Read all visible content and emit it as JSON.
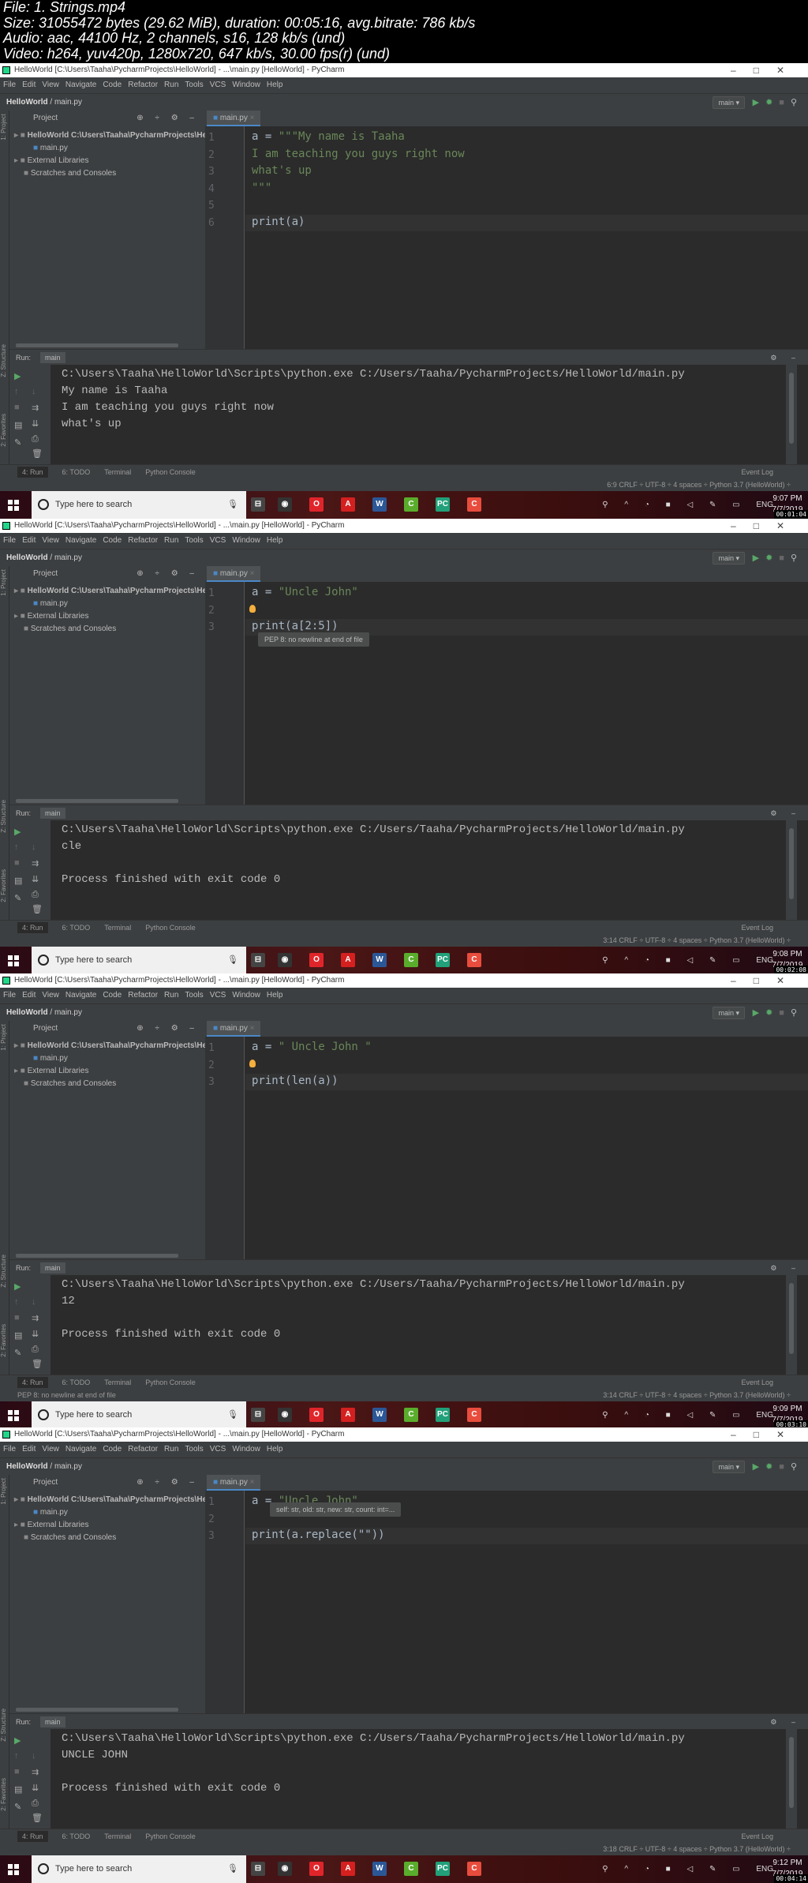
{
  "info": [
    "File: 1. Strings.mp4",
    "Size: 31055472 bytes (29.62 MiB), duration: 00:05:16, avg.bitrate: 786 kb/s",
    "Audio: aac, 44100 Hz, 2 channels, s16, 128 kb/s (und)",
    "Video: h264, yuv420p, 1280x720, 647 kb/s, 30.00 fps(r) (und)"
  ],
  "common": {
    "window_title": "HelloWorld [C:\\Users\\Taaha\\PycharmProjects\\HelloWorld] - ...\\main.py [HelloWorld] - PyCharm",
    "menu": [
      "File",
      "Edit",
      "View",
      "Navigate",
      "Code",
      "Refactor",
      "Run",
      "Tools",
      "VCS",
      "Window",
      "Help"
    ],
    "breadcrumb_project": "HelloWorld",
    "breadcrumb_file": "main.py",
    "run_config": "main",
    "project_label": "Project",
    "side_project": "1: Project",
    "side_structure": "Z: Structure",
    "side_favorites": "2: Favorites",
    "tree": [
      "HelloWorld  C:\\Users\\Taaha\\PycharmProjects\\He",
      "main.py",
      "External Libraries",
      "Scratches and Consoles"
    ],
    "tab": "main.py",
    "run_label": "Run:",
    "run_tab": "main",
    "tool_tabs": [
      "4: Run",
      "6: TODO",
      "Terminal",
      "Python Console"
    ],
    "event_log": "Event Log",
    "status_right": "CRLF ÷  UTF-8 ÷  4 spaces ÷  Python 3.7 (HelloWorld) ÷",
    "search_placeholder": "Type here to search",
    "tray_lang": "ENG",
    "date": "7/7/2019",
    "colors": {
      "accent": "#4a88c7",
      "string": "#6a8759",
      "run": "#59a869",
      "bulb": "#f4af3d"
    }
  },
  "frames": [
    {
      "code": [
        {
          "pre": "a = ",
          "str": "\"\"\"My name is Taaha"
        },
        {
          "pre": "",
          "str": "I am teaching you guys right now"
        },
        {
          "pre": "",
          "str": "what's up"
        },
        {
          "pre": "",
          "str": "\"\"\""
        },
        {
          "pre": "",
          "str": ""
        },
        {
          "pre": "print(a)",
          "str": ""
        }
      ],
      "current_line": 6,
      "bulb": false,
      "tooltip": "",
      "console": [
        "C:\\Users\\Taaha\\HelloWorld\\Scripts\\python.exe C:/Users/Taaha/PycharmProjects/HelloWorld/main.py",
        "My name is Taaha",
        "I am teaching you guys right now",
        "what's up"
      ],
      "status_msg": "",
      "caret": "6:9",
      "time": "9:07 PM",
      "timestamp": "00:01:04"
    },
    {
      "code": [
        {
          "pre": "a = ",
          "str": "\"Uncle John\""
        },
        {
          "pre": "",
          "str": ""
        },
        {
          "pre": "print(a[2:5])",
          "str": ""
        }
      ],
      "current_line": 3,
      "bulb": true,
      "tooltip": "PEP 8: no newline at end of file",
      "console": [
        "C:\\Users\\Taaha\\HelloWorld\\Scripts\\python.exe C:/Users/Taaha/PycharmProjects/HelloWorld/main.py",
        "cle",
        "",
        "Process finished with exit code 0"
      ],
      "status_msg": "",
      "caret": "3:14",
      "time": "9:08 PM",
      "timestamp": "00:02:08"
    },
    {
      "code": [
        {
          "pre": "a = ",
          "str": "\" Uncle John \""
        },
        {
          "pre": "",
          "str": ""
        },
        {
          "pre": "print(len(a))",
          "str": ""
        }
      ],
      "current_line": 3,
      "bulb": true,
      "tooltip": "",
      "console": [
        "C:\\Users\\Taaha\\HelloWorld\\Scripts\\python.exe C:/Users/Taaha/PycharmProjects/HelloWorld/main.py",
        "12",
        "",
        "Process finished with exit code 0"
      ],
      "status_msg": "PEP 8: no newline at end of file",
      "caret": "3:14",
      "time": "9:09 PM",
      "timestamp": "00:03:10"
    },
    {
      "code": [
        {
          "pre": "a = ",
          "str": "\"Uncle John\""
        },
        {
          "pre": "",
          "str": ""
        },
        {
          "pre": "print(a.replace(\"\"))",
          "str": ""
        }
      ],
      "current_line": 3,
      "bulb": false,
      "tooltip": "self: str, old: str, new: str, count: int=...",
      "console": [
        "C:\\Users\\Taaha\\HelloWorld\\Scripts\\python.exe C:/Users/Taaha/PycharmProjects/HelloWorld/main.py",
        "UNCLE JOHN",
        "",
        "Process finished with exit code 0"
      ],
      "status_msg": "",
      "caret": "3:18",
      "time": "9:12 PM",
      "timestamp": "00:04:14"
    }
  ]
}
